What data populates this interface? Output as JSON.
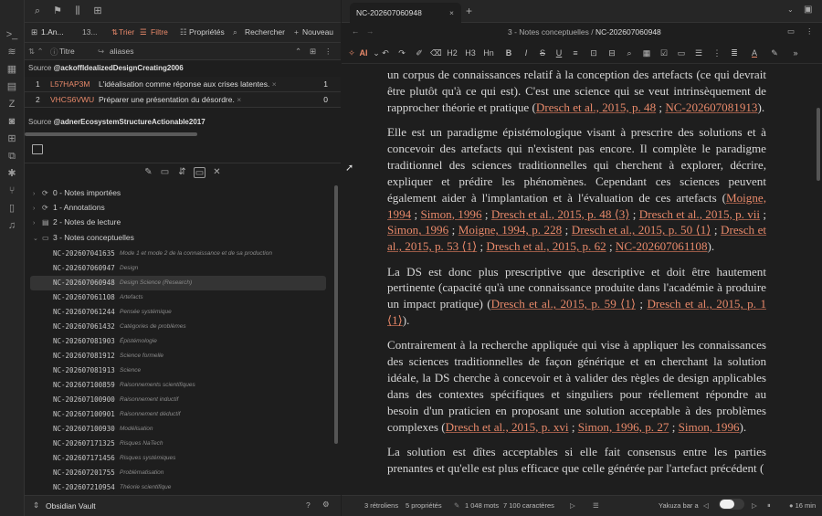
{
  "left_header": {
    "tab_active": "1.An...",
    "tab_other": "13..."
  },
  "bases_toolbar": {
    "sort": "Trier",
    "filter": "Filtre",
    "properties": "Propriétés",
    "search": "Rechercher",
    "new": "Nouveau"
  },
  "columns": {
    "title": "Titre",
    "aliases": "aliases"
  },
  "groups": [
    {
      "label": "Source",
      "source": "@ackoffIdealizedDesignCreating2006",
      "rows": [
        {
          "num": "1",
          "id": "L57HAP3M",
          "text": "L'idéalisation comme réponse aux crises latentes.",
          "count": "1"
        },
        {
          "num": "2",
          "id": "VHCS6VWU",
          "text": "Préparer une présentation du désordre.",
          "count": "0"
        }
      ]
    },
    {
      "label": "Source",
      "source": "@adnerEcosystemStructureActionable2017",
      "rows": []
    }
  ],
  "tree": [
    {
      "label": "0 - Notes importées",
      "expanded": false
    },
    {
      "label": "1 - Annotations",
      "expanded": false
    },
    {
      "label": "2 - Notes de lecture",
      "expanded": false
    },
    {
      "label": "3 - Notes conceptuelles",
      "expanded": true
    }
  ],
  "notes": [
    {
      "id": "NC-202607041635",
      "title": "Mode 1 et mode 2 de la connaissance et de sa production"
    },
    {
      "id": "NC-202607060947",
      "title": "Design"
    },
    {
      "id": "NC-202607060948",
      "title": "Design Science (Research)",
      "active": true
    },
    {
      "id": "NC-202607061108",
      "title": "Artefacts"
    },
    {
      "id": "NC-202607061244",
      "title": "Pensée systémique"
    },
    {
      "id": "NC-202607061432",
      "title": "Catégories de problèmes"
    },
    {
      "id": "NC-202607081903",
      "title": "Épistémologie"
    },
    {
      "id": "NC-202607081912",
      "title": "Science formelle"
    },
    {
      "id": "NC-202607081913",
      "title": "Science"
    },
    {
      "id": "NC-202607100859",
      "title": "Raisonnements scientifiques"
    },
    {
      "id": "NC-202607100900",
      "title": "Raisonnement inductif"
    },
    {
      "id": "NC-202607100901",
      "title": "Raisonnement déductif"
    },
    {
      "id": "NC-202607100930",
      "title": "Modélisation"
    },
    {
      "id": "NC-202607171325",
      "title": "Risques NaTech"
    },
    {
      "id": "NC-202607171456",
      "title": "Risques systémiques"
    },
    {
      "id": "NC-202607201755",
      "title": "Problématisation"
    },
    {
      "id": "NC-202607210954",
      "title": "Théorie scientifique"
    }
  ],
  "vault": {
    "name": "Obsidian Vault"
  },
  "editor_tab": {
    "title": "NC-202607060948"
  },
  "breadcrumb": {
    "folder": "3 - Notes conceptuelles",
    "sep": "/",
    "note": "NC-202607060948"
  },
  "toolbar": {
    "ai": "AI",
    "h2": "H2",
    "h3": "H3",
    "hn": "Hn"
  },
  "paragraphs": [
    [
      {
        "t": "un corpus de connaissances relatif à la conception des artefacts (ce qui devrait être plutôt qu'à ce qui est). C'est une science qui se veut intrinsèquement de rapprocher théorie et pratique ("
      },
      {
        "l": "Dresch et al., 2015, p. 48"
      },
      {
        "t": " ; "
      },
      {
        "l": "NC-202607081913"
      },
      {
        "t": ")."
      }
    ],
    [
      {
        "t": "Elle est un paradigme épistémologique visant à prescrire des solutions et à concevoir des artefacts qui n'existent pas encore. Il complète le paradigme traditionnel des sciences traditionnelles qui cherchent à explorer, décrire, expliquer et prédire les phénomènes. Cependant ces sciences peuvent également aider à l'implantation et à l'évaluation de ces artefacts ("
      },
      {
        "l": "Moigne, 1994"
      },
      {
        "t": " ; "
      },
      {
        "l": "Simon, 1996"
      },
      {
        "t": " ; "
      },
      {
        "l": "Dresch et al., 2015, p. 48 ⟨3⟩"
      },
      {
        "t": " ; "
      },
      {
        "l": "Dresch et al., 2015, p. vii"
      },
      {
        "t": " ; "
      },
      {
        "l": "Simon, 1996"
      },
      {
        "t": " ; "
      },
      {
        "l": "Moigne, 1994, p. 228"
      },
      {
        "t": " ; "
      },
      {
        "l": "Dresch et al., 2015, p. 50 ⟨1⟩"
      },
      {
        "t": " ; "
      },
      {
        "l": "Dresch et al., 2015, p. 53 ⟨1⟩"
      },
      {
        "t": " ; "
      },
      {
        "l": "Dresch et al., 2015, p. 62"
      },
      {
        "t": " ; "
      },
      {
        "l": "NC-202607061108"
      },
      {
        "t": ")."
      }
    ],
    [
      {
        "t": "La DS est donc plus prescriptive que descriptive et doit être hautement pertinente (capacité qu'à une connaissance produite dans l'académie à produire un impact pratique) ("
      },
      {
        "l": "Dresch et al., 2015, p. 59 ⟨1⟩"
      },
      {
        "t": " ; "
      },
      {
        "l": "Dresch et al., 2015, p. 1 ⟨1⟩"
      },
      {
        "t": ")."
      }
    ],
    [
      {
        "t": "Contrairement à la recherche appliquée qui vise à appliquer les connaissances des sciences traditionnelles de façon générique et en cherchant la solution idéale, la DS cherche à concevoir et à valider des règles de design applicables dans des contextes spécifiques et singuliers pour réellement répondre au besoin d'un praticien en proposant une solution acceptable à des problèmes complexes ("
      },
      {
        "l": "Dresch et al., 2015, p. xvi"
      },
      {
        "t": " ; "
      },
      {
        "l": "Simon, 1996, p. 27"
      },
      {
        "t": " ; "
      },
      {
        "l": "Simon, 1996"
      },
      {
        "t": ")."
      }
    ],
    [
      {
        "t": "La solution est dîtes acceptables si elle fait consensus entre les parties prenantes et qu'elle est plus efficace que celle générée par l'artefact précédent ("
      }
    ]
  ],
  "status": {
    "backlinks": "3 rétroliens",
    "properties": "5 propriétés",
    "words": "1 048 mots",
    "chars": "7 100 caractères",
    "player": "Yakuza bar a",
    "read_time": "16 min"
  }
}
